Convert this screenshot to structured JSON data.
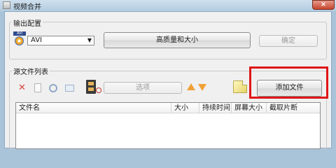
{
  "window": {
    "title": "视频合并",
    "close_label": "×"
  },
  "output_group": {
    "legend": "输出配置",
    "format_select_value": "AVI",
    "format_icon_text": "AVI",
    "quality_button_label": "高质量和大小",
    "confirm_button_label": "确定"
  },
  "source_group": {
    "legend": "源文件列表",
    "options_button_label": "选项",
    "add_file_button_label": "添加文件",
    "table_columns": [
      "文件名",
      "大小",
      "持续时间",
      "屏幕大小",
      "截取片断"
    ]
  },
  "colors": {
    "highlight": "#e01616",
    "delete_icon": "#d9463a",
    "arrow_icon": "#f0a23a"
  }
}
